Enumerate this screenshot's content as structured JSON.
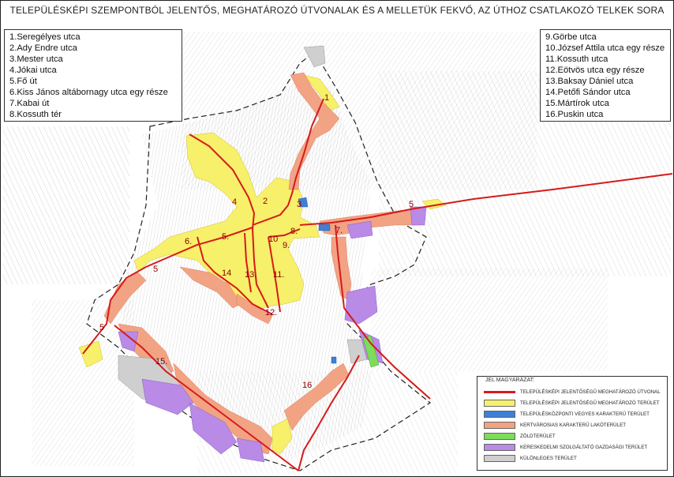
{
  "title": "TELEPÜLÉSKÉPI SZEMPONTBÓL JELENTŐS, MEGHATÁROZÓ ÚTVONALAK ÉS A MELLETÜK FEKVŐ, AZ ÚTHOZ CSATLAKOZÓ TELKEK SORA",
  "streets_left": [
    "1.Seregélyes utca",
    "2.Ady Endre utca",
    "3.Mester utca",
    "4.Jókai utca",
    "5.Fő út",
    "6.Kiss János altábornagy utca egy része",
    "7.Kabai út",
    "8.Kossuth tér"
  ],
  "streets_right": [
    "9.Görbe utca",
    "10.József Attila utca egy része",
    "11.Kossuth utca",
    "12.Eötvös utca egy része",
    "13.Baksay Dániel utca",
    "14.Petőfi Sándor utca",
    "15.Mártírok utca",
    "16.Puskin utca"
  ],
  "map_labels": [
    "1",
    "2",
    "3",
    "4",
    "5",
    "5",
    "5",
    "6.",
    "5.",
    "7.",
    "8.",
    "9.",
    "10",
    "11.",
    "12.",
    "13.",
    "14",
    "15.",
    "16"
  ],
  "legend": {
    "title": "JEL MAGYARÁZAT:",
    "items": [
      {
        "text": "TELEPÜLÉSKÉPI JELENTŐSÉGŰ MEGHATÁROZÓ ÚTVONAL",
        "kind": "line",
        "color": "#d61a1a"
      },
      {
        "text": "TELEPÜLÉSKÉPI JELENTŐSÉGŰ MEGHATÁROZÓ TERÜLET",
        "kind": "fill",
        "color": "#f7f06a"
      },
      {
        "text": "TELEPÜLÉSKÖZPONTI VEGYES KARAKTERŰ TERÜLET",
        "kind": "fill",
        "color": "#3f7fd6"
      },
      {
        "text": "KERTVÁROSIAS KARAKTERŰ LAKÓTERÜLET",
        "kind": "fill",
        "color": "#f2a384"
      },
      {
        "text": "ZÖLDTERÜLET",
        "kind": "fill",
        "color": "#7ddc5a"
      },
      {
        "text": "KERESKEDELMI SZOLGÁLTATÓ GAZDASÁGI TERÜLET",
        "kind": "fill",
        "color": "#b98ae6"
      },
      {
        "text": "KÜLÖNLEGES TERÜLET",
        "kind": "fill",
        "color": "#cfcfcf"
      }
    ]
  },
  "colors": {
    "route": "#d61a1a",
    "yellow_zone": "#f7f06a",
    "salmon_zone": "#f2a384",
    "purple_zone": "#b98ae6",
    "grey_zone": "#cfcfcf",
    "green_zone": "#7ddc5a",
    "blue_zone": "#3f7fd6"
  }
}
